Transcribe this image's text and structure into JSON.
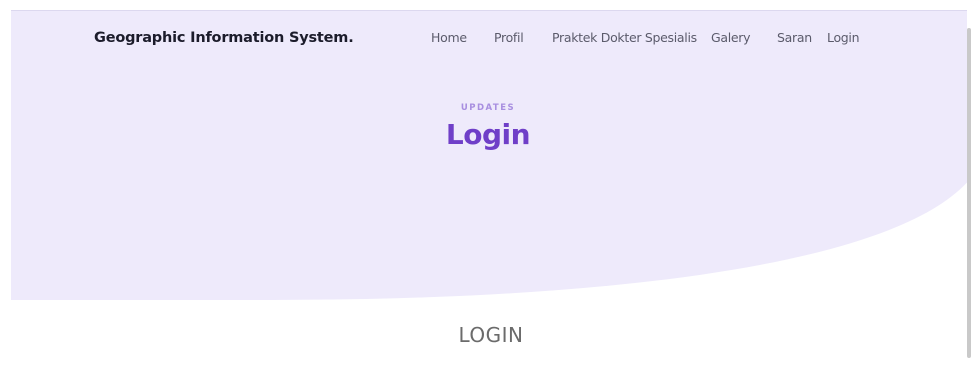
{
  "header": {
    "brand": "Geographic Information System."
  },
  "nav": {
    "items": [
      {
        "label": "Home"
      },
      {
        "label": "Profil"
      },
      {
        "label": "Praktek Dokter Spesialis"
      },
      {
        "label": "Galery"
      },
      {
        "label": "Saran"
      },
      {
        "label": "Login"
      }
    ]
  },
  "hero": {
    "eyebrow": "UPDATES",
    "title": "Login"
  },
  "main": {
    "heading": "LOGIN"
  },
  "colors": {
    "hero_background": "#eeeafb",
    "accent": "#6f3fc8",
    "eyebrow": "#a88fe0"
  }
}
